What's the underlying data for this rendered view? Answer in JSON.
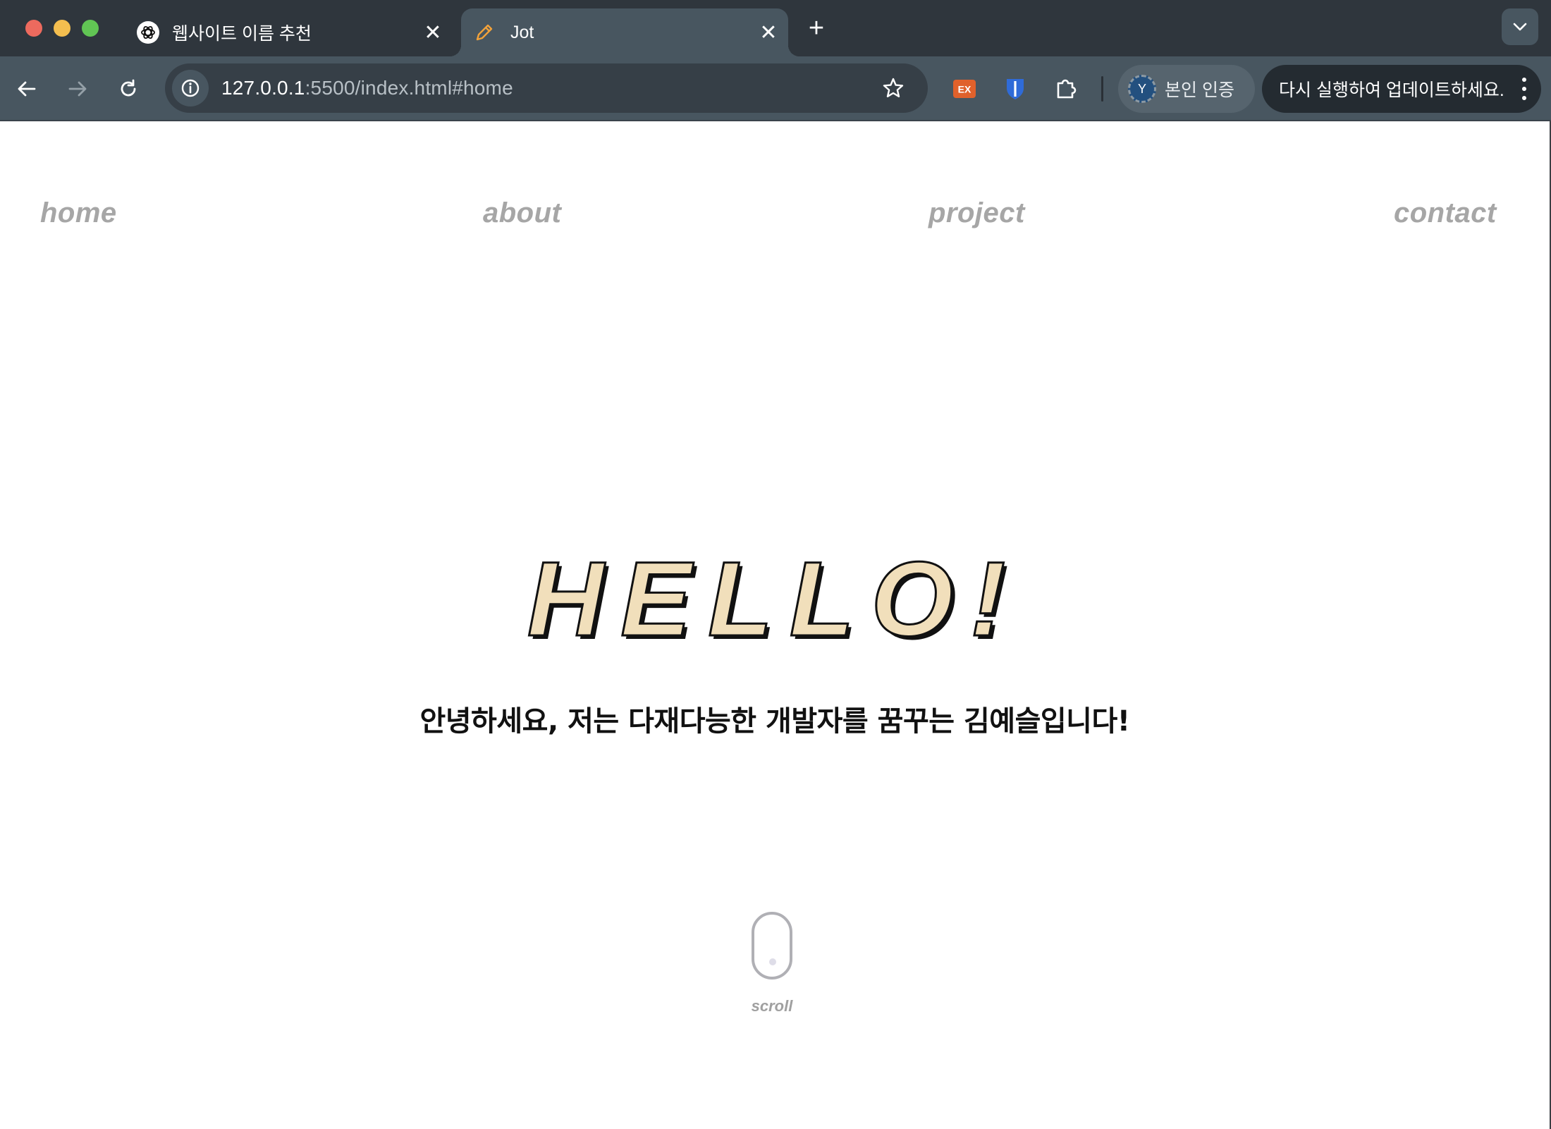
{
  "browser": {
    "tabs": [
      {
        "title": "웹사이트 이름 추천",
        "favicon": "openai-icon",
        "active": false
      },
      {
        "title": "Jot",
        "favicon": "pencil-icon",
        "active": true
      }
    ],
    "new_tab_symbol": "+",
    "tab_close_symbol": "✕",
    "address": {
      "host": "127.0.0.1",
      "rest": ":5500/index.html#home"
    },
    "extensions": [
      {
        "name": "ex-extension-icon",
        "label": "EX",
        "color": "#e0612b"
      },
      {
        "name": "bitwarden-shield-icon",
        "color": "#2f6bd8"
      },
      {
        "name": "puzzle-extensions-icon"
      }
    ],
    "profile": {
      "avatar_letter": "Y",
      "label": "본인 인증"
    },
    "update_banner": "다시 실행하여 업데이트하세요."
  },
  "page": {
    "nav": [
      "home",
      "about",
      "project",
      "contact"
    ],
    "hero_title": "HELLO!",
    "hero_fill": "#f1dfbb",
    "subtitle": "안녕하세요, 저는 다재다능한 개발자를 꿈꾸는 김예슬입니다!",
    "scroll_label": "scroll"
  }
}
